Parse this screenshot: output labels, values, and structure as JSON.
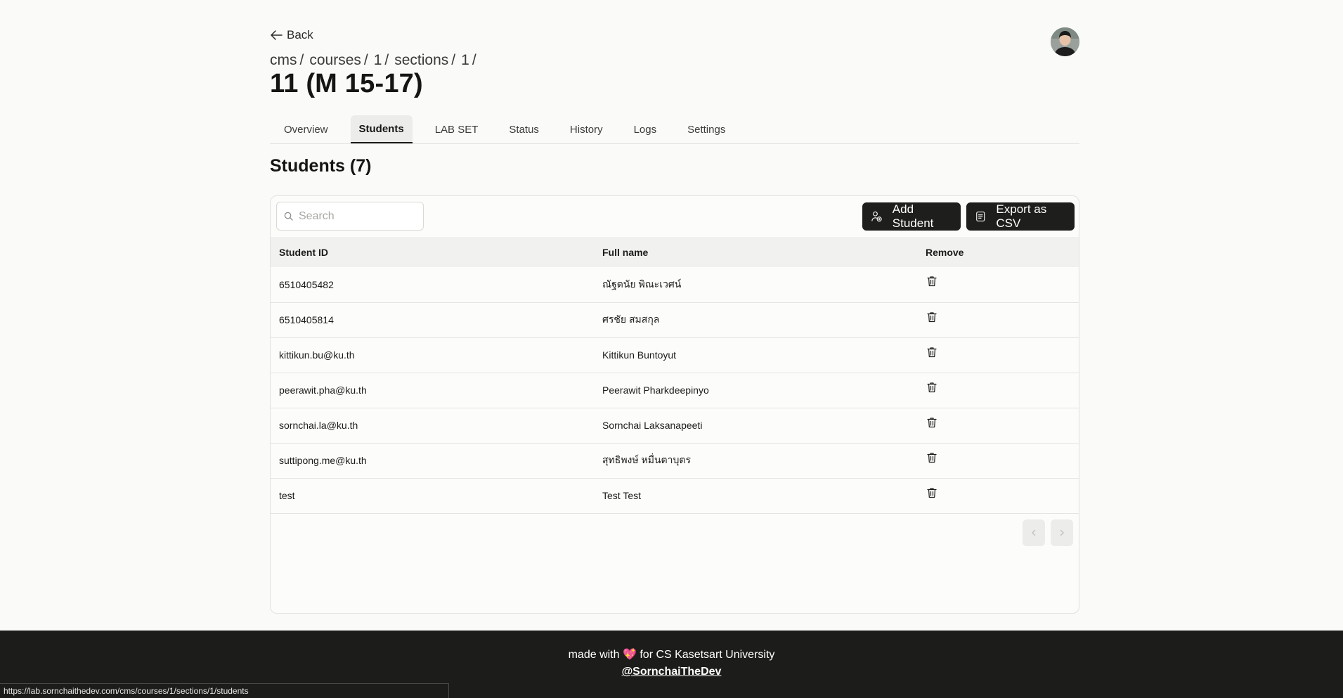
{
  "nav": {
    "back_label": "Back"
  },
  "breadcrumb": [
    "cms",
    "courses",
    "1",
    "sections",
    "1"
  ],
  "page_title": "11 (M 15-17)",
  "tabs": [
    {
      "label": "Overview",
      "active": false
    },
    {
      "label": "Students",
      "active": true
    },
    {
      "label": "LAB SET",
      "active": false
    },
    {
      "label": "Status",
      "active": false
    },
    {
      "label": "History",
      "active": false
    },
    {
      "label": "Logs",
      "active": false
    },
    {
      "label": "Settings",
      "active": false
    }
  ],
  "section_title": "Students (7)",
  "toolbar": {
    "search_placeholder": "Search",
    "search_value": "",
    "add_label": "Add Student",
    "export_label": "Export as CSV"
  },
  "table": {
    "headers": [
      "Student ID",
      "Full name",
      "Remove"
    ],
    "rows": [
      {
        "id": "6510405482",
        "name": "ณัฐดนัย พิณะเวศน์"
      },
      {
        "id": "6510405814",
        "name": "ศรชัย สมสกุล"
      },
      {
        "id": "kittikun.bu@ku.th",
        "name": "Kittikun Buntoyut"
      },
      {
        "id": "peerawit.pha@ku.th",
        "name": "Peerawit Pharkdeepinyo"
      },
      {
        "id": "sornchai.la@ku.th",
        "name": "Sornchai Laksanapeeti"
      },
      {
        "id": "suttipong.me@ku.th",
        "name": "สุทธิพงษ์ หมื่นตาบุตร"
      },
      {
        "id": "test",
        "name": "Test Test"
      }
    ]
  },
  "footer": {
    "made_prefix": "made with",
    "heart": "💖",
    "made_suffix": "for CS Kasetsart University",
    "handle": "@SornchaiTheDev"
  },
  "status_url": "https://lab.sornchaithedev.com/cms/courses/1/sections/1/students",
  "colors": {
    "primary": "#1e1e1c",
    "background": "#fafaf8",
    "footer": "#1c1c1a"
  }
}
